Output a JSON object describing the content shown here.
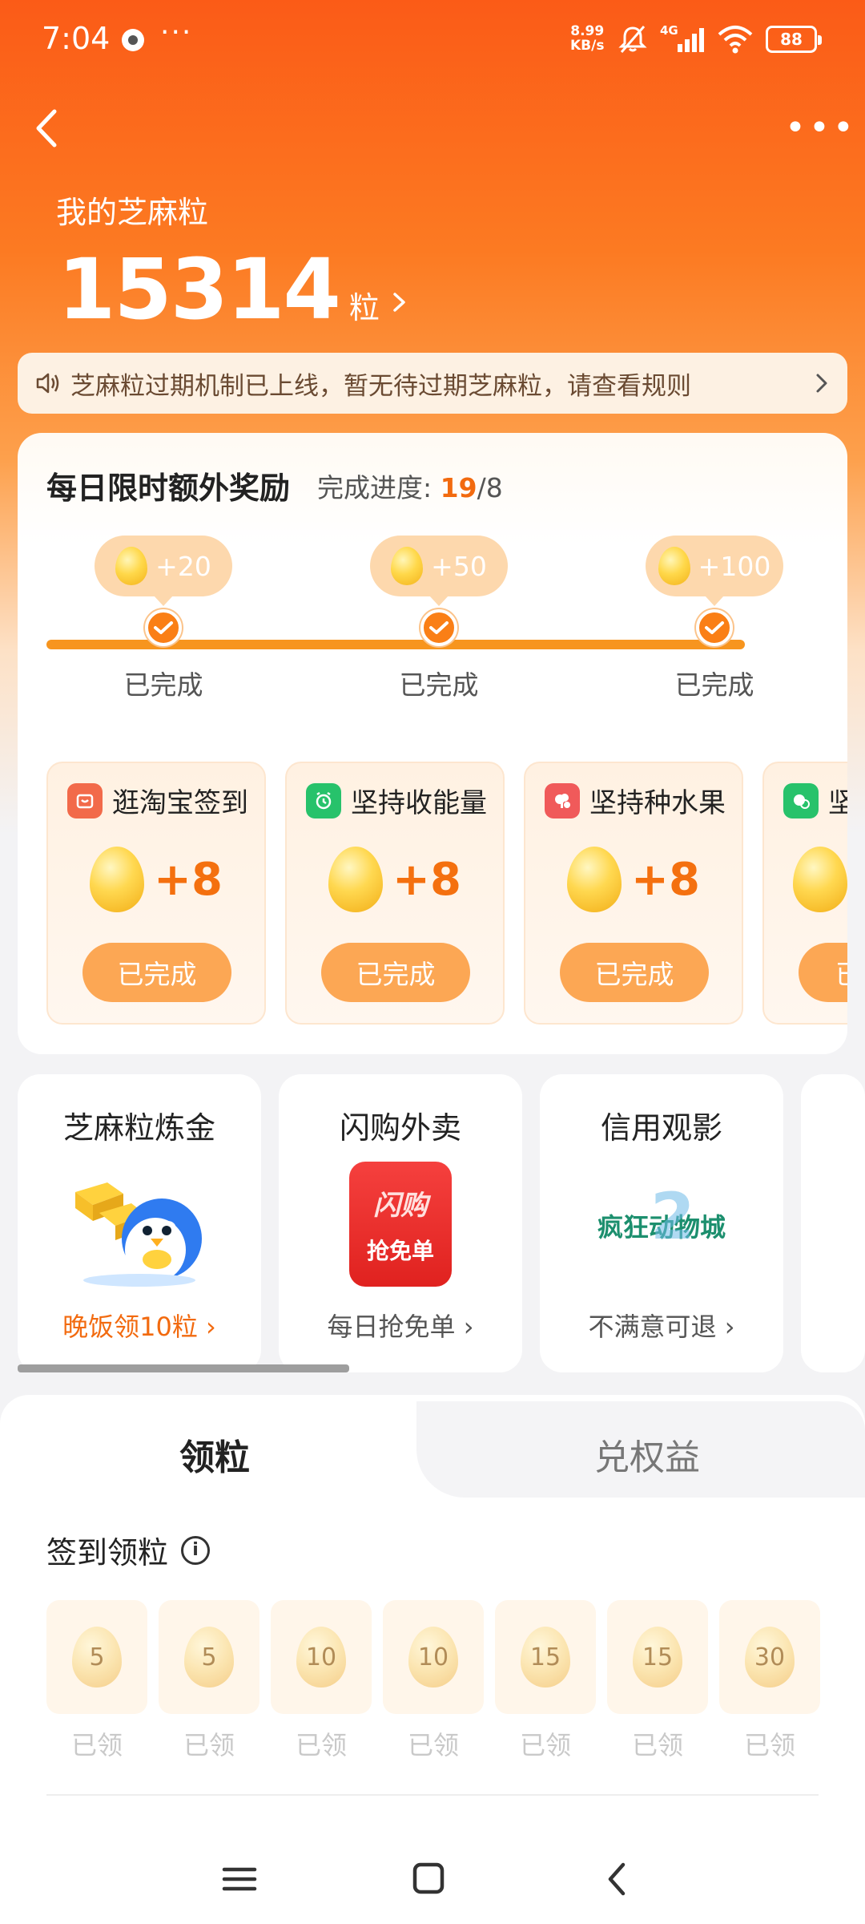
{
  "status_bar": {
    "time": "7:04",
    "more": "···",
    "net_speed_value": "8.99",
    "net_speed_unit": "KB/s",
    "network_type": "4G",
    "battery": "88",
    "icons": [
      "notification-icon",
      "mute-icon",
      "signal-icon",
      "wifi-icon",
      "battery-icon"
    ]
  },
  "header": {
    "more": "•••",
    "title": "我的芝麻粒",
    "points": "15314",
    "points_unit": "粒"
  },
  "notice": {
    "text": "芝麻粒过期机制已上线，暂无待过期芝麻粒，请查看规则"
  },
  "daily": {
    "title": "每日限时额外奖励",
    "progress_label": "完成进度:",
    "progress_current": "19",
    "progress_sep": "/",
    "progress_total": "8",
    "milestones": [
      {
        "reward": "+20",
        "status": "已完成"
      },
      {
        "reward": "+50",
        "status": "已完成"
      },
      {
        "reward": "+100",
        "status": "已完成"
      }
    ],
    "tasks": [
      {
        "name": "逛淘宝签到",
        "reward": "+8",
        "button": "已完成",
        "icon": "taobao-icon",
        "color": "#f26a4a"
      },
      {
        "name": "坚持收能量",
        "reward": "+8",
        "button": "已完成",
        "icon": "alarm-icon",
        "color": "#27c26b"
      },
      {
        "name": "坚持种水果",
        "reward": "+8",
        "button": "已完成",
        "icon": "fruit-tree-icon",
        "color": "#f05a5a"
      },
      {
        "name": "坚",
        "reward": "",
        "button": "已",
        "icon": "plant-icon",
        "color": "#27c26b"
      }
    ]
  },
  "benefits": [
    {
      "title": "芝麻粒炼金",
      "sub": "晚饭领10粒",
      "image": "penguin-gold-icon"
    },
    {
      "title": "闪购外卖",
      "sub": "每日抢免单",
      "image_text_top": "闪购",
      "image_text_bottom": "抢免单"
    },
    {
      "title": "信用观影",
      "sub": "不满意可退",
      "image_text": "疯狂动物城",
      "image_badge": "2"
    }
  ],
  "tabs": {
    "active": "领粒",
    "inactive": "兑权益"
  },
  "checkin": {
    "title": "签到领粒",
    "days": [
      {
        "value": "5",
        "label": "已领"
      },
      {
        "value": "5",
        "label": "已领"
      },
      {
        "value": "10",
        "label": "已领"
      },
      {
        "value": "10",
        "label": "已领"
      },
      {
        "value": "15",
        "label": "已领"
      },
      {
        "value": "15",
        "label": "已领"
      },
      {
        "value": "30",
        "label": "已领"
      }
    ]
  },
  "colors": {
    "brand_orange": "#fa7f16",
    "reward_orange": "#f4700f",
    "notice_bg": "#fdf1e3"
  }
}
